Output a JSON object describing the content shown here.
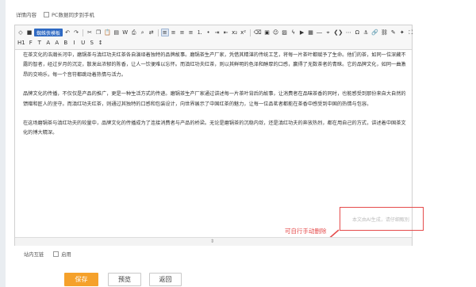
{
  "detail": {
    "label": "详情内容",
    "sync_label": "PC数据同步到手机"
  },
  "toolbar": {
    "row1": [
      {
        "name": "source-code-icon",
        "glyph": "◇"
      },
      {
        "name": "blue-tool-icon",
        "glyph": "■"
      },
      {
        "name": "spiderman-template-button",
        "label": "蜘蛛侠模板"
      },
      {
        "name": "undo-icon",
        "glyph": "↶"
      },
      {
        "name": "redo-icon",
        "glyph": "↷"
      },
      {
        "name": "cut-icon",
        "glyph": "✂"
      },
      {
        "name": "copy-icon",
        "glyph": "❐"
      },
      {
        "name": "paste-icon",
        "glyph": "📋"
      },
      {
        "name": "paste-text-icon",
        "glyph": "▤"
      },
      {
        "name": "paste-word-icon",
        "glyph": "W"
      },
      {
        "name": "print-icon",
        "glyph": "⎙"
      },
      {
        "name": "find-icon",
        "glyph": "⌕"
      },
      {
        "name": "replace-icon",
        "glyph": "⇄"
      },
      {
        "name": "align-left-icon",
        "glyph": "≡"
      },
      {
        "name": "align-center-icon",
        "glyph": "≡"
      },
      {
        "name": "align-right-icon",
        "glyph": "≡"
      },
      {
        "name": "align-justify-icon",
        "glyph": "≡"
      },
      {
        "name": "ordered-list-icon",
        "glyph": "⒈"
      },
      {
        "name": "unordered-list-icon",
        "glyph": "•"
      },
      {
        "name": "indent-icon",
        "glyph": "⇥"
      },
      {
        "name": "outdent-icon",
        "glyph": "⇤"
      },
      {
        "name": "subscript-icon",
        "glyph": "x₂"
      },
      {
        "name": "superscript-icon",
        "glyph": "x²"
      },
      {
        "name": "clear-format-icon",
        "glyph": "⌫"
      },
      {
        "name": "select-all-icon",
        "glyph": "▣"
      },
      {
        "name": "emoticon-icon",
        "glyph": "☺"
      },
      {
        "name": "image-icon",
        "glyph": "▨"
      },
      {
        "name": "flash-icon",
        "glyph": "ϟ"
      },
      {
        "name": "media-icon",
        "glyph": "▶"
      },
      {
        "name": "table-icon",
        "glyph": "▦"
      },
      {
        "name": "horizontal-rule-icon",
        "glyph": "―"
      },
      {
        "name": "map-icon",
        "glyph": "⌖"
      },
      {
        "name": "code-icon",
        "glyph": "❮❯"
      },
      {
        "name": "page-break-icon",
        "glyph": "⋯"
      },
      {
        "name": "special-char-icon",
        "glyph": "Ω"
      },
      {
        "name": "anchor-icon",
        "glyph": "⚓"
      },
      {
        "name": "link-icon",
        "glyph": "🔗"
      },
      {
        "name": "unlink-icon",
        "glyph": "⛓"
      },
      {
        "name": "highlight-icon",
        "glyph": "✎"
      },
      {
        "name": "clean-icon",
        "glyph": "✦"
      },
      {
        "name": "fullscreen-icon",
        "glyph": "⛶"
      }
    ],
    "row2": [
      {
        "name": "heading-icon",
        "glyph": "H1"
      },
      {
        "name": "font-family-icon",
        "glyph": "F"
      },
      {
        "name": "font-size-icon",
        "glyph": "T"
      },
      {
        "name": "font-color-icon",
        "glyph": "A"
      },
      {
        "name": "background-color-icon",
        "glyph": "A"
      },
      {
        "name": "bold-icon",
        "glyph": "B"
      },
      {
        "name": "italic-icon",
        "glyph": "I"
      },
      {
        "name": "underline-icon",
        "glyph": "U"
      },
      {
        "name": "strikethrough-icon",
        "glyph": "S"
      },
      {
        "name": "line-height-icon",
        "glyph": "↕"
      }
    ]
  },
  "content": {
    "paragraphs": [
      "在茶文化的浩瀚长河中，磨锅茶与滇红功夫红茶各自演绎着独特的品牌故事。磨锅茶生产厂家，凭借其精湛的传统工艺，将每一片茶叶都赋予了生命。他们的茶，如同一位深藏不露的智者，经过岁月的沉淀，散发出浓郁的陈香，让人一饮便难以忘怀。而滇红功夫红茶，则以其鲜明的色泽和醇厚的口感，赢得了无数茶者的青睐。它的品牌文化，如同一曲激昂的交响乐，每一个音符都跳动着热情与活力。",
      "品牌文化的传播，不仅仅是产品的推广，更是一种生活方式的传递。磨锅茶生产厂家通过讲述每一片茶叶背后的故事，让消费者在品味茶香的同时，也能感受到那份来自大自然的馈赠和匠人的坚守。而滇红功夫红茶，则通过其独特的口感和包装设计，向世界展示了中国红茶的魅力，让每一位品茗者都能在茶香中感受到中国的热情与包容。",
      "在这场磨锅茶与滇红功夫的较量中，品牌文化的传播成为了连接消费者与产品的桥梁。无论是磨锅茶的沉稳内敛，还是滇红功夫的奔放热烈，都在用自己的方式，讲述着中国茶文化的博大精深。"
    ],
    "ai_note": "本文由AI生成，请仔细甄别"
  },
  "annotation": {
    "label": "可自行手动删除",
    "color": "#e54b4b"
  },
  "link_row": {
    "label": "站内互链",
    "option": "启用"
  },
  "buttons": {
    "save": "保存",
    "preview": "预览",
    "back": "返回"
  },
  "colors": {
    "save_button": "#f5a12b",
    "toolbar_active": "#2e69c3"
  }
}
